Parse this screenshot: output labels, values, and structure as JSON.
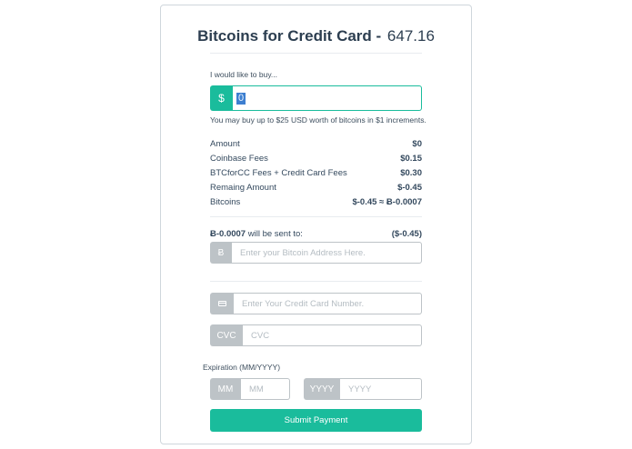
{
  "header": {
    "title": "Bitcoins for Credit Card - ",
    "price": "647.16"
  },
  "amount": {
    "label": "I would like to buy...",
    "currency_symbol": "$",
    "value": "0",
    "help_text": "You may buy up to $25 USD worth of bitcoins in $1 increments."
  },
  "summary": [
    {
      "label": "Amount",
      "value": "$0"
    },
    {
      "label": "Coinbase Fees",
      "value": "$0.15"
    },
    {
      "label": "BTCforCC Fees + Credit Card Fees",
      "value": "$0.30"
    },
    {
      "label": "Remaing Amount",
      "value": "$-0.45"
    },
    {
      "label": "Bitcoins",
      "value": "$-0.45 ≈ Ƀ-0.0007"
    }
  ],
  "send": {
    "btc_amount": "Ƀ-0.0007",
    "text": " will be sent to:",
    "usd_amount": "($-0.45)"
  },
  "address": {
    "addon": "Ƀ",
    "placeholder": "Enter your Bitcoin Address Here."
  },
  "card_number": {
    "placeholder": "Enter Your Credit Card Number."
  },
  "cvc": {
    "addon": "CVC",
    "placeholder": "CVC"
  },
  "expiration": {
    "label": "Expiration (MM/YYYY)",
    "month_addon": "MM",
    "month_placeholder": "MM",
    "year_addon": "YYYY",
    "year_placeholder": "YYYY"
  },
  "submit_label": "Submit Payment",
  "colors": {
    "accent": "#1abc9c",
    "addon_gray": "#bdc3c7",
    "text": "#34495e"
  }
}
